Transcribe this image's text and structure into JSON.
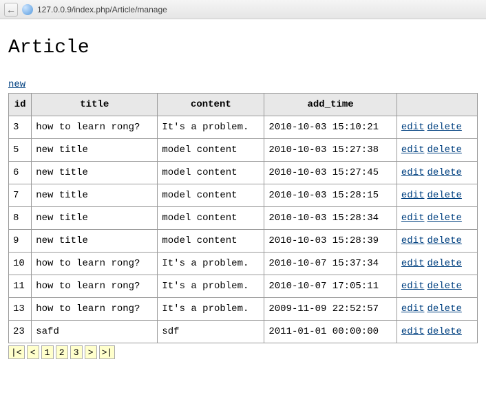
{
  "browser": {
    "url": "127.0.0.9/index.php/Article/manage"
  },
  "page": {
    "heading": "Article",
    "new_link": "new"
  },
  "table": {
    "headers": [
      "id",
      "title",
      "content",
      "add_time",
      ""
    ],
    "rows": [
      {
        "id": "3",
        "title": "how to learn rong?",
        "content": "It's a problem.",
        "add_time": "2010-10-03 15:10:21"
      },
      {
        "id": "5",
        "title": "new title",
        "content": "model content",
        "add_time": "2010-10-03 15:27:38"
      },
      {
        "id": "6",
        "title": "new title",
        "content": "model content",
        "add_time": "2010-10-03 15:27:45"
      },
      {
        "id": "7",
        "title": "new title",
        "content": "model content",
        "add_time": "2010-10-03 15:28:15"
      },
      {
        "id": "8",
        "title": "new title",
        "content": "model content",
        "add_time": "2010-10-03 15:28:34"
      },
      {
        "id": "9",
        "title": "new title",
        "content": "model content",
        "add_time": "2010-10-03 15:28:39"
      },
      {
        "id": "10",
        "title": "how to learn rong?",
        "content": "It's a problem.",
        "add_time": "2010-10-07 15:37:34"
      },
      {
        "id": "11",
        "title": "how to learn rong?",
        "content": "It's a problem.",
        "add_time": "2010-10-07 17:05:11"
      },
      {
        "id": "13",
        "title": "how to learn rong?",
        "content": "It's a problem.",
        "add_time": "2009-11-09 22:52:57"
      },
      {
        "id": "23",
        "title": "safd",
        "content": "sdf",
        "add_time": "2011-01-01 00:00:00"
      }
    ],
    "action_edit": "edit",
    "action_delete": "delete"
  },
  "pager": {
    "first": "|<",
    "prev": "<",
    "pages": [
      "1",
      "2",
      "3"
    ],
    "next": ">",
    "last": ">|"
  }
}
